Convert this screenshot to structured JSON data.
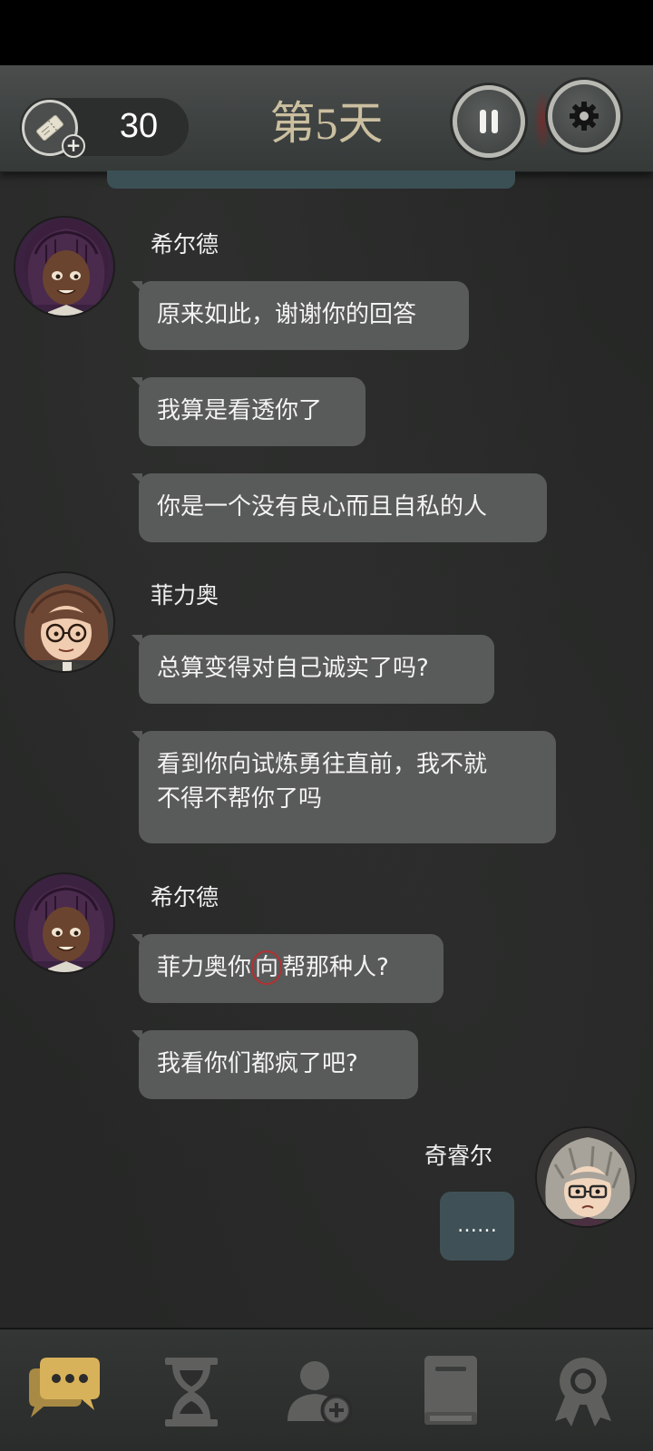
{
  "header": {
    "currency_value": "30",
    "day_title": "第5天",
    "ticket_icon": "ticket-add-icon",
    "pause_icon": "pause-icon",
    "settings_icon": "gear-icon"
  },
  "messages": [
    {
      "sender": "希尔德",
      "texts": [
        "原来如此，谢谢你的回答",
        "我算是看透你了",
        "你是一个没有良心而且自私的人"
      ]
    },
    {
      "sender": "菲力奥",
      "texts": [
        "总算变得对自己诚实了吗?",
        "看到你向试炼勇往直前，我不就\n不得不帮你了吗"
      ]
    },
    {
      "sender": "希尔德",
      "texts_parts": {
        "before": "菲力奥你",
        "marked": "向",
        "after": "帮那种人?"
      },
      "texts": [
        "我看你们都疯了吧?"
      ]
    },
    {
      "sender": "奇睿尔",
      "texts": [
        "……"
      ]
    }
  ],
  "colors": {
    "bubble_other": "#595a5a",
    "bubble_self": "#3f5156",
    "day_title": "#cbbfa0",
    "nav_active": "#d8b25a",
    "nav_inactive": "#5f605d"
  },
  "nav": [
    {
      "icon": "chat-icon",
      "active": true
    },
    {
      "icon": "hourglass-icon",
      "active": false
    },
    {
      "icon": "add-friend-icon",
      "active": false
    },
    {
      "icon": "book-icon",
      "active": false
    },
    {
      "icon": "award-icon",
      "active": false
    }
  ]
}
